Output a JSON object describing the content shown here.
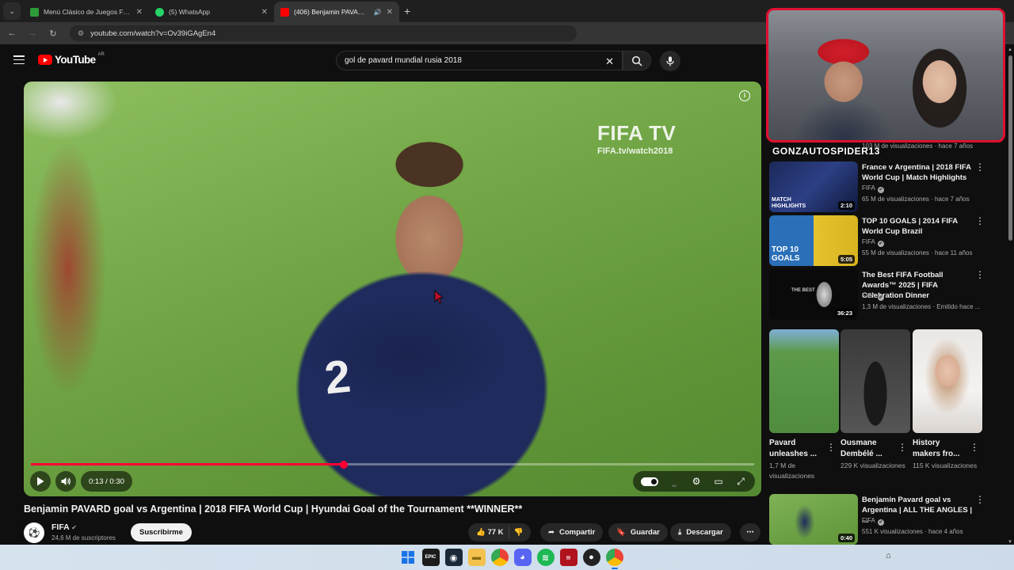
{
  "browser": {
    "tabs": [
      {
        "title": "Menú Clásico de Juegos Friv | F",
        "favicon_color": "#2e9b3a",
        "active": false
      },
      {
        "title": "(5) WhatsApp",
        "favicon_color": "#25d366",
        "active": false
      },
      {
        "title": "(406) Benjamin PAVARD go",
        "favicon_color": "#ff0000",
        "active": true
      }
    ],
    "url": "youtube.com/watch?v=Ov39iGAgEn4"
  },
  "youtube": {
    "logo_text": "YouTube",
    "country_code": "AR",
    "search_value": "gol de pavard mundial rusia 2018"
  },
  "player": {
    "watermark_title": "FIFA TV",
    "watermark_url": "FIFA.tv/watch2018",
    "jersey_number": "2",
    "time_display": "0:13 / 0:30",
    "progress": 0.433,
    "accent_color": "#ff0033"
  },
  "video": {
    "title": "Benjamin PAVARD goal vs Argentina | 2018 FIFA World Cup | Hyundai Goal of the Tournament **WINNER**",
    "channel": "FIFA",
    "subscribers": "24,6 M de suscriptores",
    "subscribe_label": "Suscribirme",
    "likes": "77 K",
    "share_label": "Compartir",
    "save_label": "Guardar",
    "download_label": "Descargar"
  },
  "overlay": {
    "streamer_name": "GONZAUTOSPIDER13",
    "partial_meta": "103 M de visualizaciones · hace 7 años"
  },
  "recommendations": [
    {
      "title": "France v Argentina | 2018 FIFA World Cup | Match Highlights",
      "channel": "FIFA",
      "meta": "65 M de visualizaciones · hace 7 años",
      "duration": "2:10",
      "thumb_label": "MATCH HIGHLIGHTS"
    },
    {
      "title": "TOP 10 GOALS | 2014 FIFA World Cup Brazil",
      "channel": "FIFA",
      "meta": "55 M de visualizaciones · hace 11 años",
      "duration": "5:05",
      "thumb_label": "TOP 10 GOALS"
    },
    {
      "title": "The Best FIFA Football Awards™ 2025 | FIFA Celebration Dinner",
      "channel": "FIFA",
      "meta": "1,3 M de visualizaciones · Emitido hace ...",
      "duration": "36:23",
      "thumb_label": "THE BEST"
    }
  ],
  "shorts": [
    {
      "title": "Pavard unleashes ...",
      "views": "1,7 M de visualizaciones"
    },
    {
      "title": "Ousmane Dembélé ...",
      "views": "229 K visualizaciones"
    },
    {
      "title": "History makers fro...",
      "views": "115 K visualizaciones"
    }
  ],
  "last_recommendation": {
    "title": "Benjamin Pavard goal vs Argentina | ALL THE ANGLES | ...",
    "channel": "FIFA",
    "meta": "551 K visualizaciones · hace 4 años",
    "duration": "0:40"
  }
}
